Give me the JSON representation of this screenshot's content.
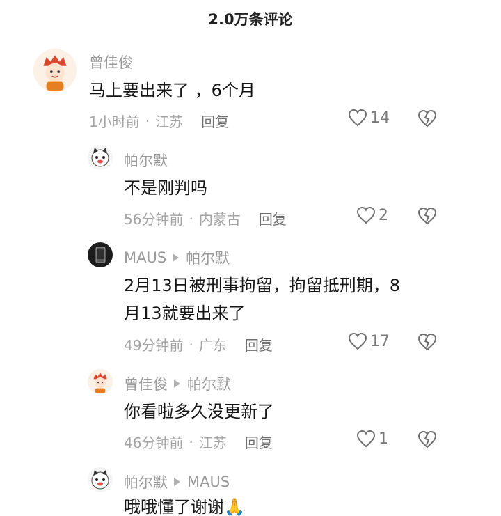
{
  "header": {
    "title": "2.0万条评论"
  },
  "comments": [
    {
      "author": "曾佳俊",
      "reply_to": "",
      "text": "马上要出来了 ，6个月",
      "time": "1小时前",
      "location": "江苏",
      "reply": "回复",
      "likes": "14",
      "avatar_icon": "cartoon-character-avatar"
    },
    {
      "author": "帕尔默",
      "reply_to": "",
      "text": "不是刚判吗",
      "time": "56分钟前",
      "location": "内蒙古",
      "reply": "回复",
      "likes": "2",
      "avatar_icon": "cat-avatar"
    },
    {
      "author": "MAUS",
      "reply_to": "帕尔默",
      "text_line1": "2月13日被刑事拘留，拘留抵刑期，8",
      "text_line2": "月13就要出来了",
      "time": "49分钟前",
      "location": "广东",
      "reply": "回复",
      "likes": "17",
      "avatar_icon": "phone-photo-avatar"
    },
    {
      "author": "曾佳俊",
      "reply_to": "帕尔默",
      "text": "你看啦多久没更新了",
      "time": "46分钟前",
      "location": "江苏",
      "reply": "回复",
      "likes": "1",
      "avatar_icon": "cartoon-character-avatar"
    },
    {
      "author": "帕尔默",
      "reply_to": "MAUS",
      "text": "哦哦懂了谢谢🙏",
      "avatar_icon": "cat-avatar"
    }
  ],
  "separator": "·"
}
